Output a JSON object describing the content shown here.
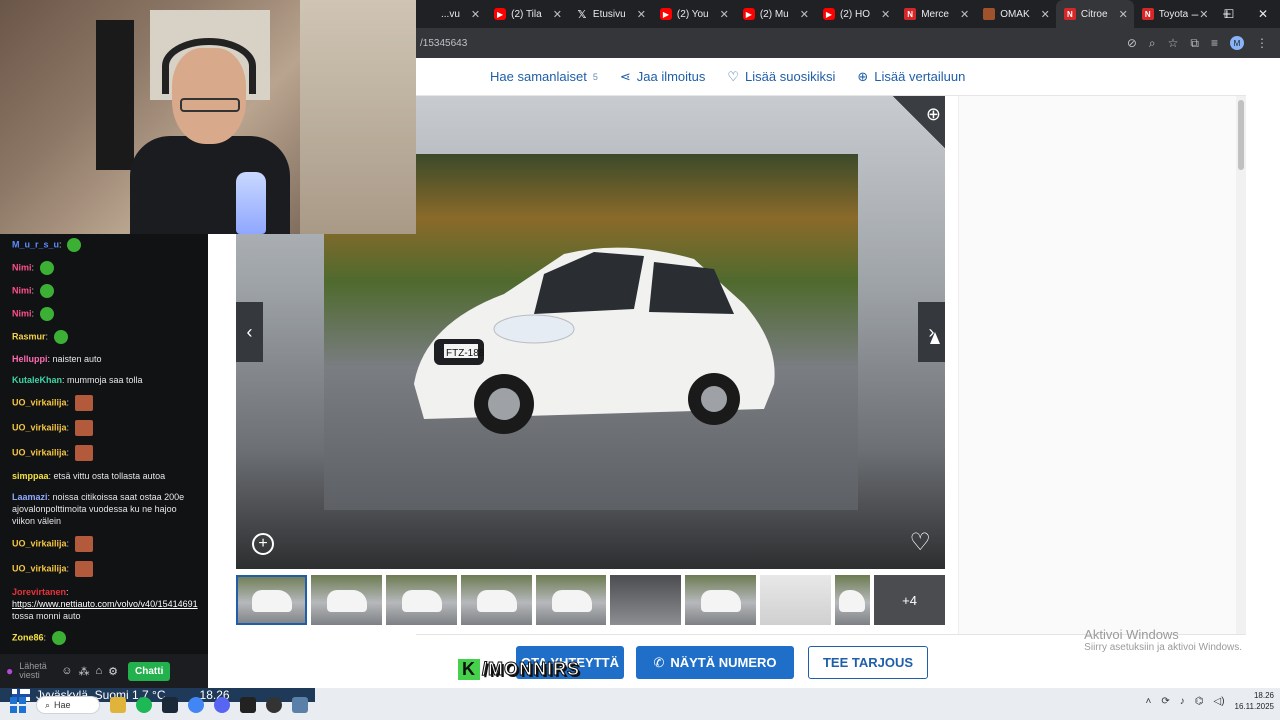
{
  "browser": {
    "tabs": [
      {
        "title": "...vu",
        "icon": "generic-icon",
        "active": false
      },
      {
        "title": "(2) Tila",
        "icon": "youtube-icon",
        "active": false
      },
      {
        "title": "Etusivu",
        "icon": "x-icon",
        "active": false
      },
      {
        "title": "(2) You",
        "icon": "youtube-icon",
        "active": false
      },
      {
        "title": "(2) Mu",
        "icon": "youtube-icon",
        "active": false
      },
      {
        "title": "(2) HO",
        "icon": "youtube-icon",
        "active": false
      },
      {
        "title": "Merce",
        "icon": "nettiauto-icon",
        "active": false
      },
      {
        "title": "OMAK",
        "icon": "omaketti-icon",
        "active": false
      },
      {
        "title": "Citroe",
        "icon": "nettiauto-icon",
        "active": true
      },
      {
        "title": "Toyota",
        "icon": "nettiauto-icon",
        "active": false
      }
    ],
    "url": "/15345643",
    "window_controls": [
      "–",
      "☐",
      "✕"
    ],
    "profile_initial": "M"
  },
  "listing": {
    "actions": [
      {
        "label": "Hae samanlaiset",
        "count": "5",
        "icon": "search-icon"
      },
      {
        "label": "Jaa ilmoitus",
        "icon": "share-icon"
      },
      {
        "label": "Lisää suosikiksi",
        "icon": "heart-icon"
      },
      {
        "label": "Lisää vertailuun",
        "icon": "plus-circle-icon"
      }
    ],
    "plate": "FTZ-188",
    "more_photos": "+4",
    "buttons": {
      "message": "OTA YHTEYTTÄ",
      "phone": "NÄYTÄ NUMERO",
      "offer": "TEE TARJOUS"
    },
    "colors": {
      "brand": "#1f5fa9",
      "cta": "#1f6fc9"
    }
  },
  "windows_watermark": {
    "title": "Aktivoi Windows",
    "subtitle": "Siirry asetuksiin ja aktivoi Windows."
  },
  "chat": {
    "messages": [
      {
        "user": "M_u_r_s_u",
        "color": "#5b8cff",
        "text": "",
        "emotes": [
          "frog"
        ]
      },
      {
        "user": "Nimi",
        "color": "#ff4f8b",
        "text": "",
        "emotes": [
          "frog"
        ]
      },
      {
        "user": "Nimi",
        "color": "#ff4f8b",
        "text": "",
        "emotes": [
          "frog"
        ]
      },
      {
        "user": "Nimi",
        "color": "#ff4f8b",
        "text": "",
        "emotes": [
          "frog"
        ]
      },
      {
        "user": "Rasmur",
        "color": "#f4d34a",
        "text": "",
        "emotes": [
          "frog"
        ]
      },
      {
        "user": "Helluppi",
        "color": "#ff6ab0",
        "text": "naisten auto",
        "emotes": []
      },
      {
        "user": "KutaleKhan",
        "color": "#3fd3a6",
        "text": "mummoja saa tolla",
        "emotes": []
      },
      {
        "user": "UO_virkailija",
        "color": "#f5c542",
        "text": "",
        "emotes": [
          "face"
        ]
      },
      {
        "user": "UO_virkailija",
        "color": "#f5c542",
        "text": "",
        "emotes": [
          "face"
        ]
      },
      {
        "user": "UO_virkailija",
        "color": "#f5c542",
        "text": "",
        "emotes": [
          "face"
        ]
      },
      {
        "user": "simppaa",
        "color": "#f5e342",
        "text": "etsä vittu osta tollasta autoa",
        "emotes": []
      },
      {
        "user": "Laamazi",
        "color": "#8fa9ff",
        "text": "noissa citikoissa saat ostaa 200e ajovalonpolttimoita vuodessa ku ne hajoo viikon välein",
        "emotes": []
      },
      {
        "user": "UO_virkailija",
        "color": "#f5c542",
        "text": "",
        "emotes": [
          "face"
        ]
      },
      {
        "user": "UO_virkailija",
        "color": "#f5c542",
        "text": "",
        "emotes": [
          "face"
        ]
      },
      {
        "user": "Jorevirtanen",
        "color": "#e8323c",
        "text": "https://www.nettiauto.com/volvo/v40/15414691",
        "extra": "tossa monni auto",
        "emotes": []
      },
      {
        "user": "Zone86",
        "color": "#f5e342",
        "text": "",
        "emotes": [
          "frog"
        ]
      }
    ],
    "input_placeholder": "Lähetä viesti",
    "send_button": "Chatti"
  },
  "stream_logo": {
    "letter": "K",
    "text": "/MONNIRS"
  },
  "taskbar": {
    "weather": "Jyväskylä, Suomi   1,7 °C",
    "overlay_time": "18.26",
    "search_label": "Hae",
    "clock_time": "18.26",
    "clock_date": "16.11.2025"
  }
}
